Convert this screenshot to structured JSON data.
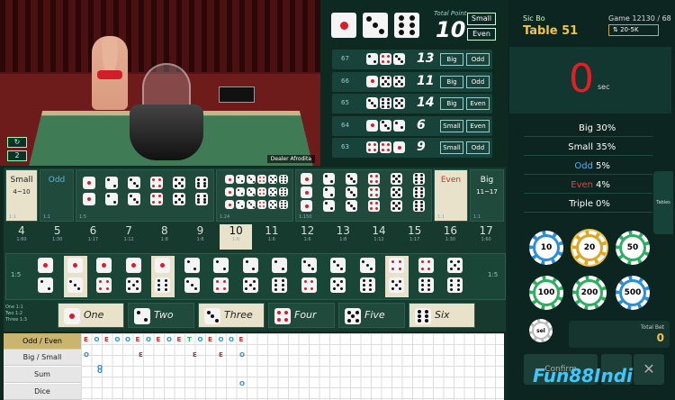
{
  "video": {
    "dealer_label": "Dealer Afrodita",
    "refresh_icon": "refresh-icon",
    "wifi_label": "2"
  },
  "result": {
    "dice": [
      1,
      3,
      6
    ],
    "total_label": "Total Point",
    "total": "10",
    "size_tag": "Small",
    "parity_tag": "Even"
  },
  "history": [
    {
      "id": "67",
      "dice": [
        2,
        4,
        3
      ],
      "total": "13",
      "size": "Big",
      "parity": "Odd"
    },
    {
      "id": "66",
      "dice": [
        1,
        5,
        5
      ],
      "total": "11",
      "size": "Big",
      "parity": "Odd"
    },
    {
      "id": "65",
      "dice": [
        3,
        6,
        5
      ],
      "total": "14",
      "size": "Big",
      "parity": "Even"
    },
    {
      "id": "64",
      "dice": [
        1,
        3,
        2
      ],
      "total": "6",
      "size": "Small",
      "parity": "Even"
    },
    {
      "id": "63",
      "dice": [
        4,
        4,
        1
      ],
      "total": "9",
      "size": "Small",
      "parity": "Odd"
    }
  ],
  "panel": {
    "game_type": "Sic Bo",
    "table": "Table 51",
    "game": "Game 12130 / 68",
    "limit": "20-5K",
    "timer": "0",
    "timer_unit": "sec",
    "tables_label": "Tables"
  },
  "stats": [
    {
      "name": "Big",
      "value": "30%",
      "color": "#ffffff"
    },
    {
      "name": "Small",
      "value": "35%",
      "color": "#ffffff"
    },
    {
      "name": "Odd",
      "value": "5%",
      "color": "#4fb3ff"
    },
    {
      "name": "Even",
      "value": "4%",
      "color": "#ff3b3b"
    },
    {
      "name": "Triple",
      "value": "0%",
      "color": "#ffffff"
    }
  ],
  "chips": [
    {
      "value": "10",
      "color": "#2a8fd6"
    },
    {
      "value": "20",
      "color": "#e0a423"
    },
    {
      "value": "50",
      "color": "#2fae62"
    },
    {
      "value": "100",
      "color": "#2fae62"
    },
    {
      "value": "200",
      "color": "#2fae62"
    },
    {
      "value": "500",
      "color": "#2a8fd6"
    }
  ],
  "sel_chip_label": "sel",
  "total_bet_label": "Total Bet",
  "total_bet_value": "0",
  "confirm_label": "Confirm",
  "logo": "Fun88Indi",
  "bet": {
    "small": "Small",
    "small_range": "4~10",
    "odd": "Odd",
    "even": "Even",
    "big": "Big",
    "big_range": "11~17",
    "pay_11": "1:1",
    "pay_15": "1:5",
    "pay_124": "1:24",
    "pay_1150": "1:150",
    "numbers": [
      {
        "n": "4",
        "p": "1:60"
      },
      {
        "n": "5",
        "p": "1:30"
      },
      {
        "n": "6",
        "p": "1:17"
      },
      {
        "n": "7",
        "p": "1:12"
      },
      {
        "n": "8",
        "p": "1:8"
      },
      {
        "n": "9",
        "p": "1:6"
      },
      {
        "n": "10",
        "p": "1:6"
      },
      {
        "n": "11",
        "p": "1:6"
      },
      {
        "n": "12",
        "p": "1:6"
      },
      {
        "n": "13",
        "p": "1:8"
      },
      {
        "n": "14",
        "p": "1:12"
      },
      {
        "n": "15",
        "p": "1:17"
      },
      {
        "n": "16",
        "p": "1:30"
      },
      {
        "n": "17",
        "p": "1:60"
      }
    ],
    "singles": [
      "One",
      "Two",
      "Three",
      "Four",
      "Five",
      "Six"
    ],
    "single_pays": [
      "One 1:1",
      "Two 1:2",
      "Three 1:3"
    ]
  },
  "road": {
    "labels": [
      "Odd / Even",
      "Big / Small",
      "Sum",
      "Dice"
    ],
    "row1": [
      "E",
      "O",
      "E",
      "O",
      "O",
      "E",
      "O",
      "E",
      "O",
      "E",
      "T",
      "O",
      "E",
      "O",
      "O",
      "E"
    ],
    "sum_marks": [
      "O",
      "O",
      "O"
    ]
  }
}
